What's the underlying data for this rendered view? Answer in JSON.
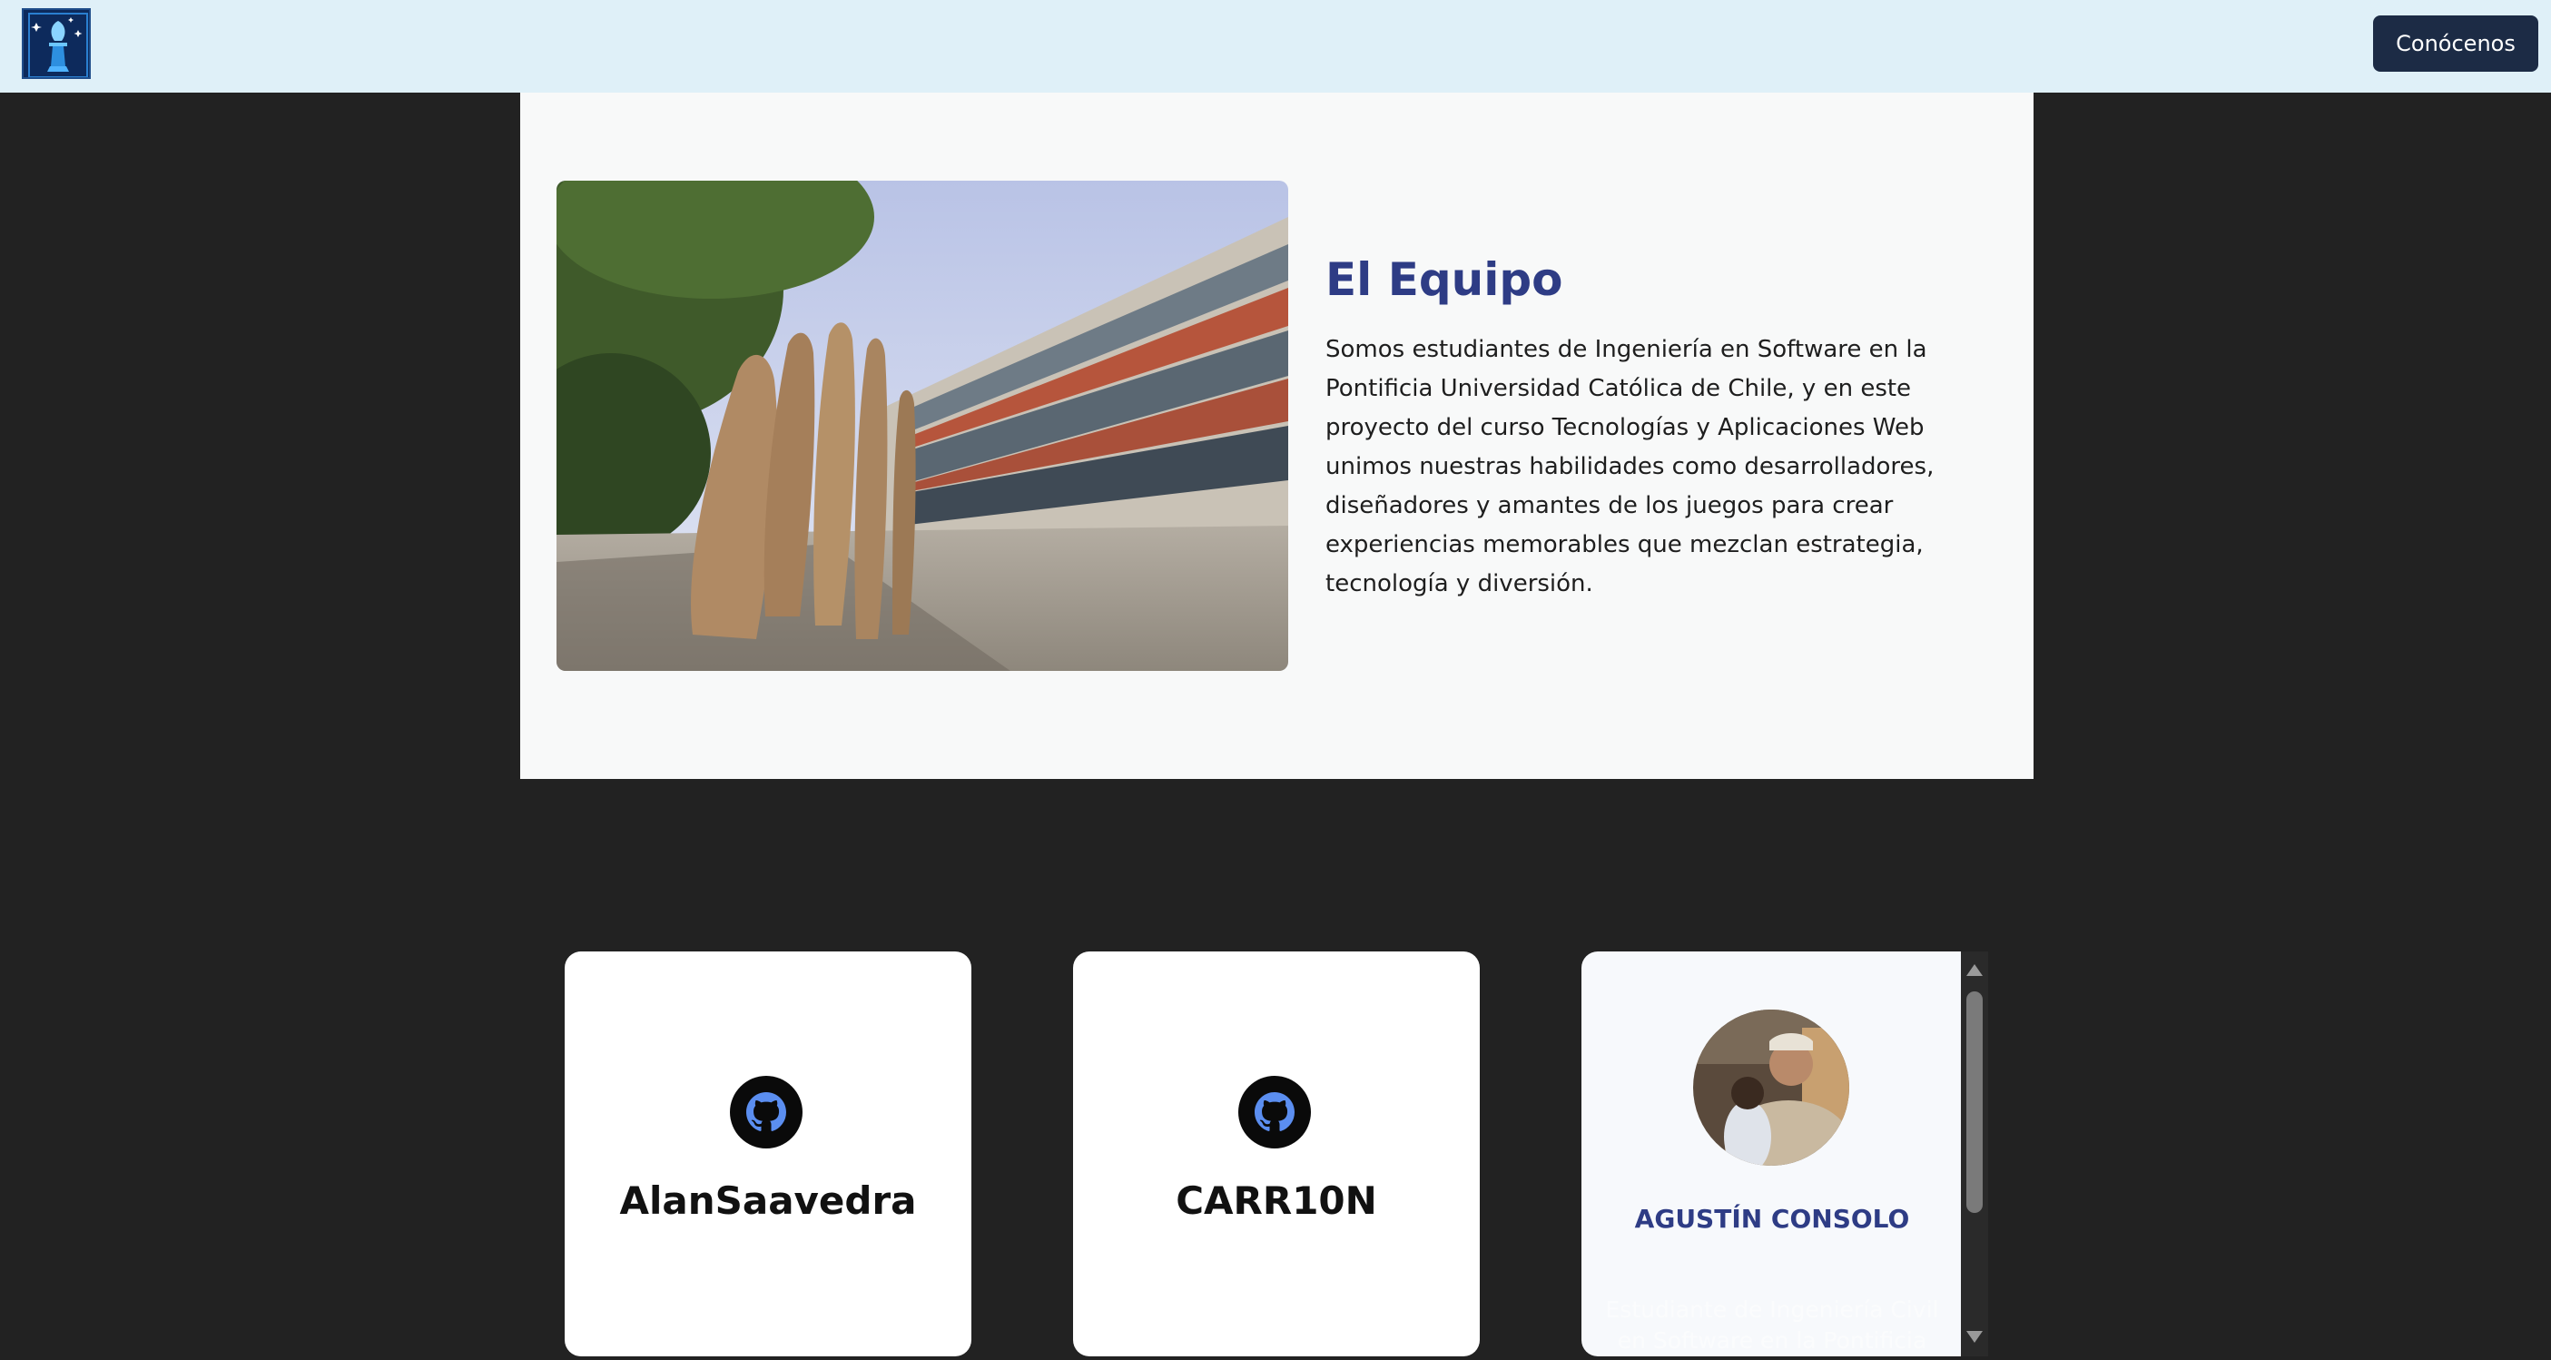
{
  "header": {
    "logo_icon": "chess-king-logo-icon",
    "cta_label": "Conócenos"
  },
  "team": {
    "title": "El Equipo",
    "description": "Somos estudiantes de Ingeniería en Software en la Pontificia Universidad Católica de Chile, y en este proyecto del curso Tecnologías y Aplicaciones Web unimos nuestras habilidades como desarrolladores, diseñadores y amantes de los juegos para crear experiencias memorables que mezclan estrategia, tecnología y diversión."
  },
  "cards": [
    {
      "name": "AlanSaavedra",
      "icon": "github-icon"
    },
    {
      "name": "CARR10N",
      "icon": "github-icon"
    }
  ],
  "member": {
    "name": "AGUSTÍN CONSOLO",
    "role": "Estudiante de Ingeniería Civil en Software en la Pontificia"
  },
  "colors": {
    "header_bg": "#dff0f8",
    "accent": "#2e3c85",
    "cta_bg": "#1c2b45",
    "page_bg": "#222222",
    "github_blue": "#5b8ef0"
  }
}
